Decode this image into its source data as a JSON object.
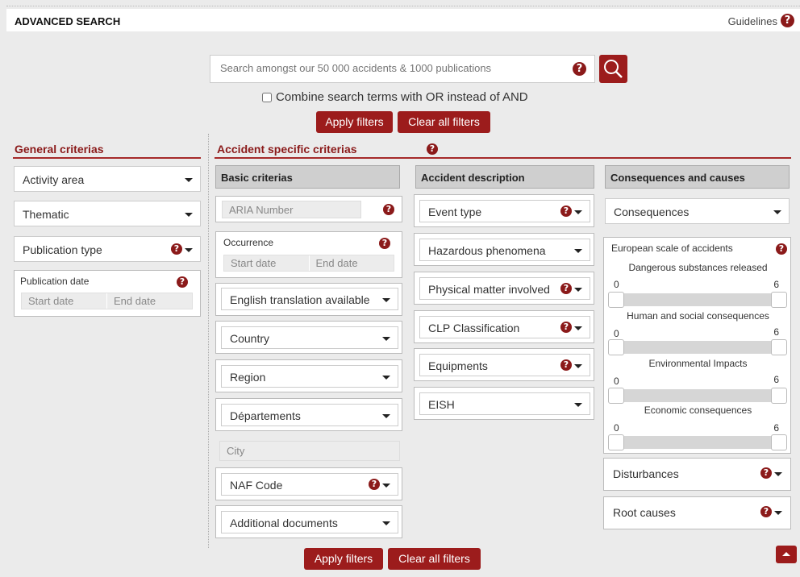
{
  "header": {
    "title": "ADVANCED SEARCH",
    "guidelines": "Guidelines"
  },
  "search": {
    "placeholder": "Search amongst our 50 000 accidents & 1000 publications",
    "combine_label": "Combine search terms with OR instead of AND"
  },
  "actions": {
    "apply": "Apply filters",
    "clear": "Clear all filters"
  },
  "general": {
    "title": "General criterias",
    "activity_area": "Activity area",
    "thematic": "Thematic",
    "publication_type": "Publication type",
    "publication_date": {
      "label": "Publication date",
      "start": "Start date",
      "end": "End date"
    }
  },
  "accident": {
    "title": "Accident specific criterias",
    "basic": {
      "heading": "Basic criterias",
      "aria_number": "ARIA Number",
      "occurrence": {
        "label": "Occurrence",
        "start": "Start date",
        "end": "End date"
      },
      "english_translation": "English translation available",
      "country": "Country",
      "region": "Region",
      "departements": "Départements",
      "city": "City",
      "naf_code": "NAF Code",
      "additional_documents": "Additional documents"
    },
    "description": {
      "heading": "Accident description",
      "event_type": "Event type",
      "hazardous_phenomena": "Hazardous phenomena",
      "physical_matter": "Physical matter involved",
      "clp": "CLP Classification",
      "equipments": "Equipments",
      "eish": "EISH"
    },
    "consequences": {
      "heading": "Consequences and causes",
      "consequences": "Consequences",
      "scale_title": "European scale of accidents",
      "sliders": [
        {
          "label": "Dangerous substances released",
          "min": "0",
          "max": "6"
        },
        {
          "label": "Human and social consequences",
          "min": "0",
          "max": "6"
        },
        {
          "label": "Environmental Impacts",
          "min": "0",
          "max": "6"
        },
        {
          "label": "Economic consequences",
          "min": "0",
          "max": "6"
        }
      ],
      "disturbances": "Disturbances",
      "root_causes": "Root causes"
    }
  },
  "colors": {
    "accent": "#9c1c1c",
    "panel_header": "#cfcfcf",
    "background": "#ebebeb"
  }
}
